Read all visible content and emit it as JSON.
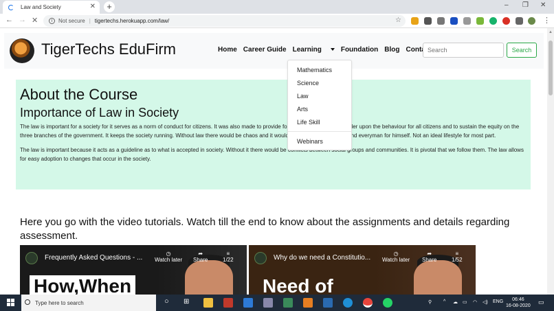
{
  "browser": {
    "tab_title": "Law and Society",
    "new_tab": "+",
    "security_label": "Not secure",
    "url": "tigertechs.herokuapp.com/law/"
  },
  "navbar": {
    "brand": "TigerTechs EduFirm",
    "links": [
      "Home",
      "Career Guide",
      "Learning",
      "Foundation",
      "Blog",
      "Contact"
    ],
    "search_placeholder": "Search",
    "search_button": "Search"
  },
  "dropdown": {
    "items": [
      "Mathematics",
      "Science",
      "Law",
      "Arts",
      "Life Skill"
    ],
    "extra": "Webinars"
  },
  "course": {
    "heading": "About the Course",
    "subheading": "Importance of Law in Society",
    "para1": "The law is important for a society for it serves as a norm of conduct for citizens. It was also made to provide for proper guidelines and order upon the behaviour for all citizens and to sustain the equity on the three branches of the government. It keeps the society running. Without law there would be chaos and it would be survival of the fittest and everyman for himself. Not an ideal lifestyle for most part.",
    "para2": "The law is important because it acts as a guideline as to what is accepted in society. Without it there would be conflicts between social groups and communities. It is pivotal that we follow them. The law allows for easy adoption to changes that occur in the society."
  },
  "videos": {
    "section_title": "Here you go with the video tutorials. Watch till the end to know about the assignments and details regarding assessment.",
    "items": [
      {
        "title": "Frequently Asked Questions - ...",
        "watch_later": "Watch later",
        "share": "Share",
        "count": "1/22",
        "overlay": "How,When"
      },
      {
        "title": "Why do we need a Constitutio...",
        "watch_later": "Watch later",
        "share": "Share",
        "count": "1/52",
        "overlay": "Need of"
      }
    ]
  },
  "taskbar": {
    "search_placeholder": "Type here to search",
    "language": "ENG",
    "time": "06:46",
    "date": "16-08-2020"
  }
}
